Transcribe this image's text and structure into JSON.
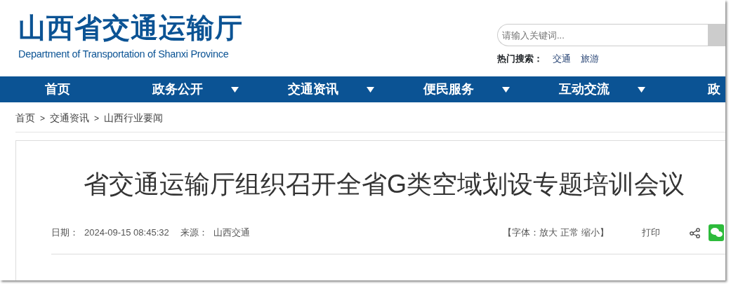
{
  "header": {
    "logo_cn": "山西省交通运输厅",
    "logo_en": "Department of Transportation of Shanxi Province",
    "search": {
      "placeholder": "请输入关键词..."
    },
    "hot_search": {
      "label": "热门搜索：",
      "terms": [
        "交通",
        "旅游"
      ]
    }
  },
  "nav": [
    {
      "label": "首页",
      "has_menu": false
    },
    {
      "label": "政务公开",
      "has_menu": true
    },
    {
      "label": "交通资讯",
      "has_menu": true
    },
    {
      "label": "便民服务",
      "has_menu": true
    },
    {
      "label": "互动交流",
      "has_menu": true
    },
    {
      "label": "政",
      "has_menu": false
    }
  ],
  "breadcrumb": [
    {
      "label": "首页",
      "separator": ">"
    },
    {
      "label": "交通资讯",
      "separator": ">"
    },
    {
      "label": "山西行业要闻"
    }
  ],
  "article": {
    "title": "省交通运输厅组织召开全省G类空域划设专题培训会议",
    "meta": {
      "date_label": "日期：",
      "date": "2024-09-15 08:45:32",
      "source_label": "来源：",
      "source": "山西交通"
    },
    "font_tools": {
      "open": "【字体：",
      "options": [
        "放大",
        "正常",
        "缩小"
      ],
      "close": "】"
    },
    "print": "打印"
  }
}
